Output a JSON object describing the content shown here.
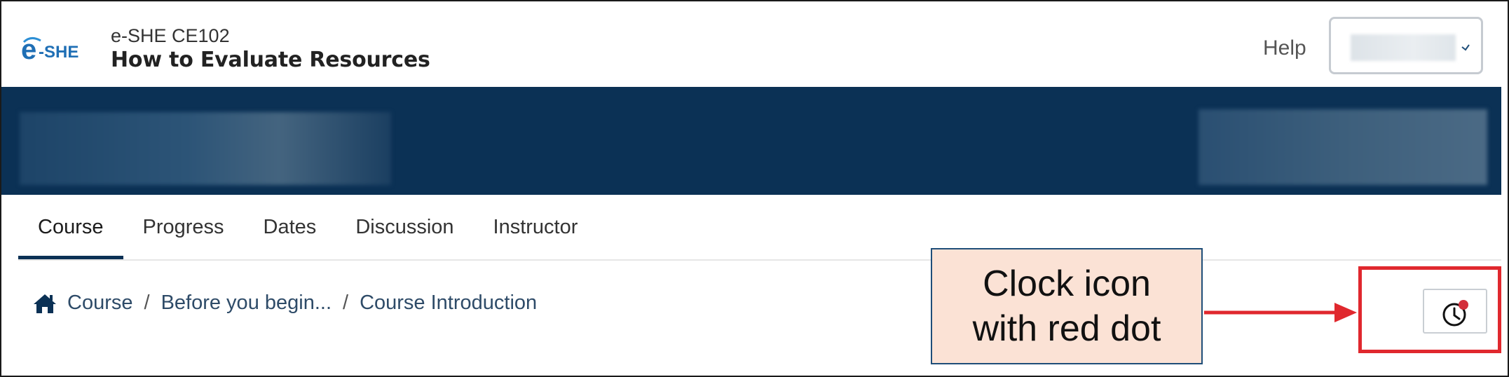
{
  "header": {
    "logo_alt": "e-SHE",
    "course_code": "e-SHE CE102",
    "course_title": "How to Evaluate Resources",
    "help_label": "Help"
  },
  "tabs": [
    {
      "label": "Course",
      "active": true
    },
    {
      "label": "Progress",
      "active": false
    },
    {
      "label": "Dates",
      "active": false
    },
    {
      "label": "Discussion",
      "active": false
    },
    {
      "label": "Instructor",
      "active": false
    }
  ],
  "breadcrumb": {
    "items": [
      "Course",
      "Before you begin...",
      "Course Introduction"
    ],
    "separator": "/"
  },
  "annotation": {
    "text": "Clock icon\nwith red dot"
  },
  "icons": {
    "home": "home-icon",
    "clock": "clock-icon",
    "notification_dot": "red-dot-icon",
    "chevron": "chevron-down-icon"
  },
  "colors": {
    "banner": "#0b3155",
    "annotation_fill": "#fbe2d5",
    "annotation_border": "#1f4e79",
    "highlight": "#e0282e",
    "notification_dot": "#d32f3a"
  }
}
